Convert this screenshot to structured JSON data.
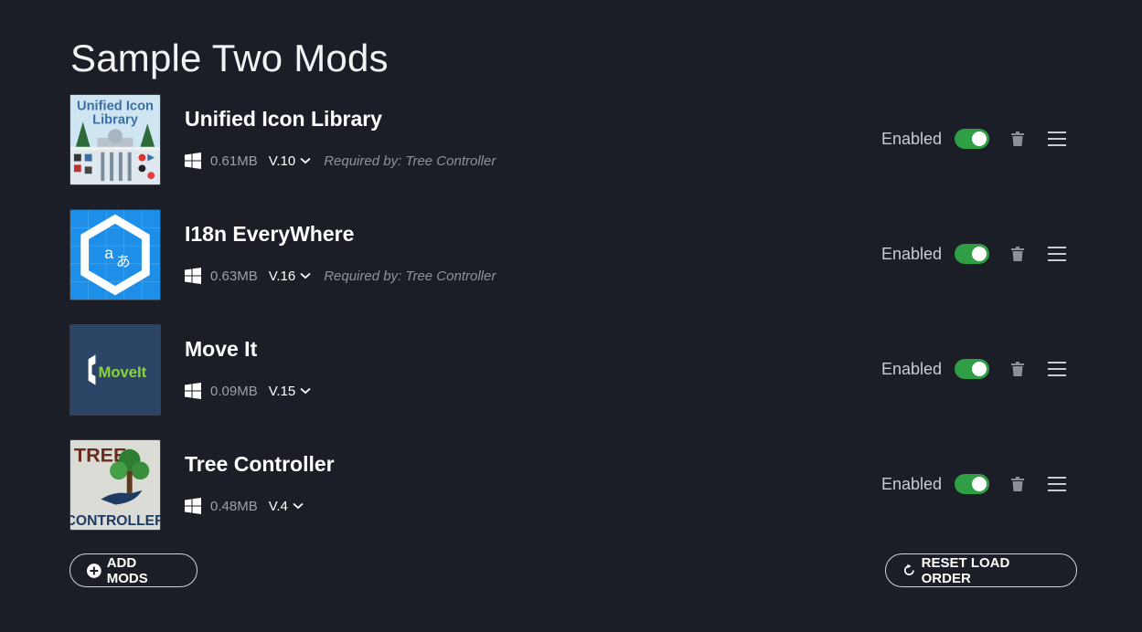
{
  "page": {
    "title": "Sample Two Mods"
  },
  "thumbs": {
    "unified": {
      "line1": "Unified Icon",
      "line2": "Library"
    },
    "moveit": {
      "brand": "MoveIt"
    },
    "tree": {
      "top": "TREE",
      "bottom": "CONTROLLER"
    },
    "i18n": {
      "glyph1": "a",
      "glyph2": "あ"
    }
  },
  "mods": [
    {
      "name": "Unified Icon Library",
      "size": "0.61MB",
      "version": "V.10",
      "required_by": "Required by: Tree Controller",
      "status": "Enabled",
      "enabled": true,
      "platform_icon": "windows-icon"
    },
    {
      "name": "I18n EveryWhere",
      "size": "0.63MB",
      "version": "V.16",
      "required_by": "Required by: Tree Controller",
      "status": "Enabled",
      "enabled": true,
      "platform_icon": "windows-icon"
    },
    {
      "name": "Move It",
      "size": "0.09MB",
      "version": "V.15",
      "required_by": "",
      "status": "Enabled",
      "enabled": true,
      "platform_icon": "windows-icon"
    },
    {
      "name": "Tree Controller",
      "size": "0.48MB",
      "version": "V.4",
      "required_by": "",
      "status": "Enabled",
      "enabled": true,
      "platform_icon": "windows-icon"
    }
  ],
  "footer": {
    "add_label": "ADD MODS",
    "reset_label": "RESET LOAD ORDER"
  },
  "colors": {
    "background": "#1b1e26",
    "toggle_on": "#2f9e44",
    "muted_text": "#9aa0aa"
  }
}
